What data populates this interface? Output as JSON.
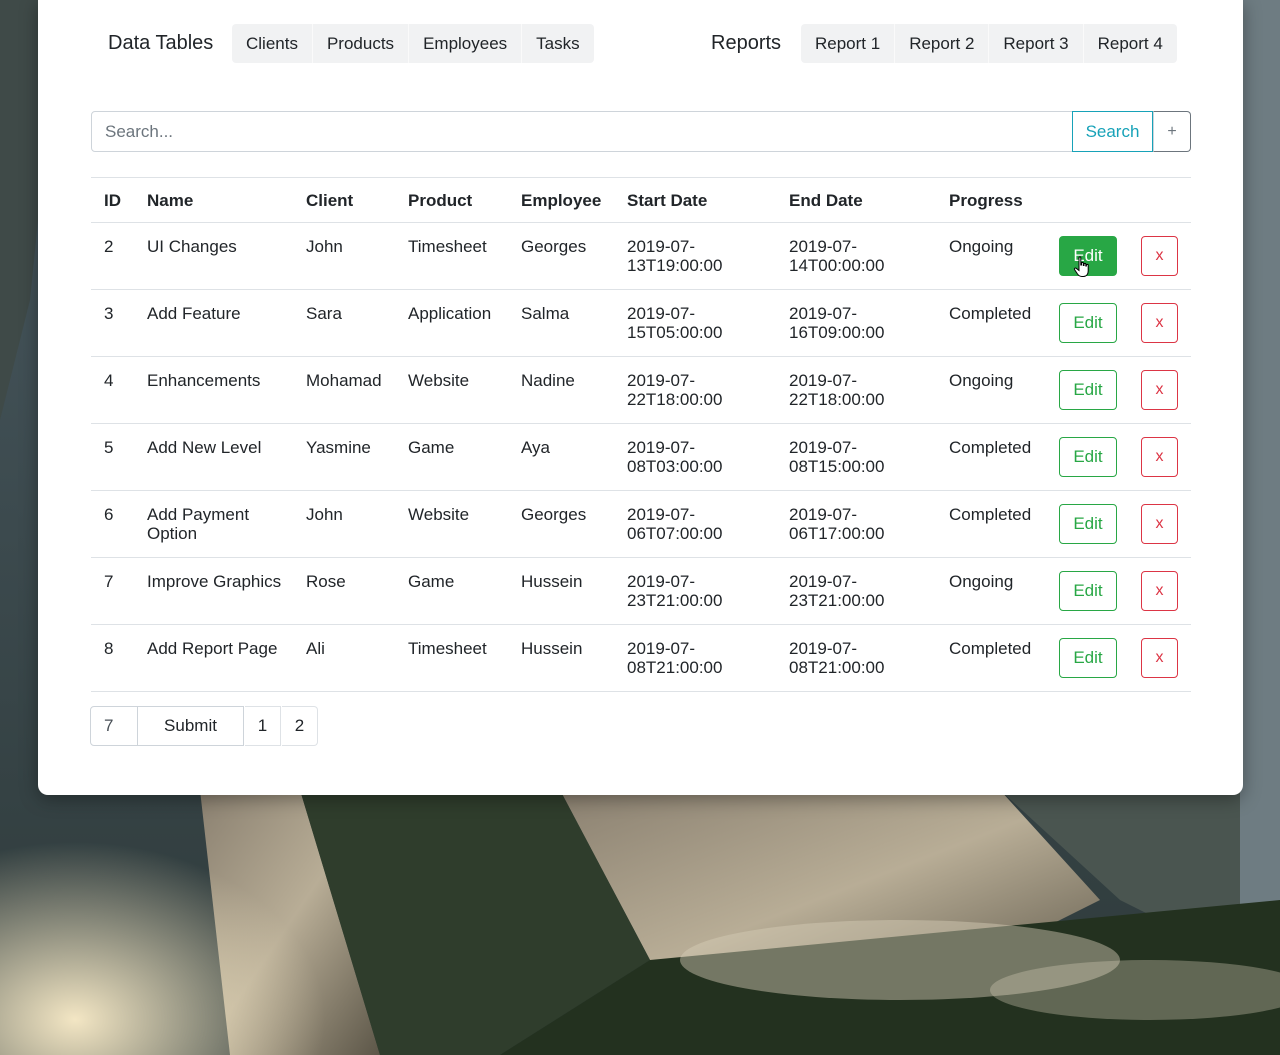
{
  "navbar": {
    "brand": "Data Tables",
    "data_links": [
      "Clients",
      "Products",
      "Employees",
      "Tasks"
    ],
    "reports_label": "Reports",
    "report_links": [
      "Report 1",
      "Report 2",
      "Report 3",
      "Report 4"
    ]
  },
  "search": {
    "placeholder": "Search...",
    "value": "",
    "button_label": "Search",
    "add_label": "+"
  },
  "table": {
    "headers": [
      "ID",
      "Name",
      "Client",
      "Product",
      "Employee",
      "Start Date",
      "End Date",
      "Progress"
    ],
    "edit_label": "Edit",
    "delete_label": "x",
    "rows": [
      {
        "id": "2",
        "name": "UI Changes",
        "client": "John",
        "product": "Timesheet",
        "employee": "Georges",
        "start": "2019-07-13T19:00:00",
        "end": "2019-07-14T00:00:00",
        "progress": "Ongoing"
      },
      {
        "id": "3",
        "name": "Add Feature",
        "client": "Sara",
        "product": "Application",
        "employee": "Salma",
        "start": "2019-07-15T05:00:00",
        "end": "2019-07-16T09:00:00",
        "progress": "Completed"
      },
      {
        "id": "4",
        "name": "Enhancements",
        "client": "Mohamad",
        "product": "Website",
        "employee": "Nadine",
        "start": "2019-07-22T18:00:00",
        "end": "2019-07-22T18:00:00",
        "progress": "Ongoing"
      },
      {
        "id": "5",
        "name": "Add New Level",
        "client": "Yasmine",
        "product": "Game",
        "employee": "Aya",
        "start": "2019-07-08T03:00:00",
        "end": "2019-07-08T15:00:00",
        "progress": "Completed"
      },
      {
        "id": "6",
        "name": "Add Payment Option",
        "client": "John",
        "product": "Website",
        "employee": "Georges",
        "start": "2019-07-06T07:00:00",
        "end": "2019-07-06T17:00:00",
        "progress": "Completed"
      },
      {
        "id": "7",
        "name": "Improve Graphics",
        "client": "Rose",
        "product": "Game",
        "employee": "Hussein",
        "start": "2019-07-23T21:00:00",
        "end": "2019-07-23T21:00:00",
        "progress": "Ongoing"
      },
      {
        "id": "8",
        "name": "Add Report Page",
        "client": "Ali",
        "product": "Timesheet",
        "employee": "Hussein",
        "start": "2019-07-08T21:00:00",
        "end": "2019-07-08T21:00:00",
        "progress": "Completed"
      }
    ]
  },
  "pagination": {
    "page_size_value": "7",
    "submit_label": "Submit",
    "pages": [
      "1",
      "2"
    ]
  },
  "colors": {
    "edit": "#28a745",
    "delete": "#dc3545",
    "search": "#17a2b8"
  }
}
